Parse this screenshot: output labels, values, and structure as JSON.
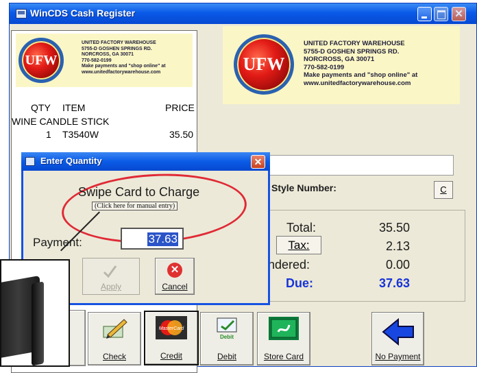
{
  "window": {
    "title": "WinCDS Cash Register",
    "close_glyph": "✕"
  },
  "store": {
    "logo_text": "UFW",
    "lines": [
      "UNITED FACTORY WAREHOUSE",
      "5755-D GOSHEN SPRINGS RD.",
      "NORCROSS, GA 30071",
      "770-582-0199",
      "Make payments and \"shop online\" at",
      "www.unitedfactorywarehouse.com"
    ]
  },
  "receipt": {
    "columns": {
      "qty": "QTY",
      "item": "ITEM",
      "price": "PRICE"
    },
    "lines": [
      {
        "description": "WINE CANDLE STICK",
        "qty": "1",
        "sku": "T3540W",
        "price": "35.50"
      }
    ]
  },
  "form": {
    "style_number_label": "Style Number:",
    "clear_button_label": "C"
  },
  "totals": {
    "total_label": "Total:",
    "total_value": "35.50",
    "tax_label": "Tax:",
    "tax_value": "2.13",
    "tendered_label": "ndered:",
    "tendered_value": "0.00",
    "due_label": "Due:",
    "due_value": "37.63"
  },
  "payment_buttons": [
    {
      "label": "Check",
      "icon": "check-pen-icon"
    },
    {
      "label": "Credit",
      "icon": "mastercard-icon"
    },
    {
      "label": "Debit",
      "icon": "debit-card-icon"
    },
    {
      "label": "Store Card",
      "icon": "store-card-icon"
    },
    {
      "label": "No Payment",
      "icon": "back-arrow-icon"
    }
  ],
  "credit_icon_text": "MasterCard",
  "debit_icon_text": "Debit",
  "dialog": {
    "title": "Enter Quantity",
    "close_glyph": "✕",
    "swipe_text": "Swipe Card to Charge",
    "manual_entry": "(Click here for manual entry)",
    "payment_label": "Payment:",
    "payment_value": "37.63",
    "apply_label": "Apply",
    "cancel_label": "Cancel",
    "cancel_glyph": "✕"
  },
  "colors": {
    "due": "#1734d8",
    "highlight_oval": "#e02a36",
    "titlebar": "#0a5ae8",
    "receipt_header": "#fbf6c5"
  }
}
